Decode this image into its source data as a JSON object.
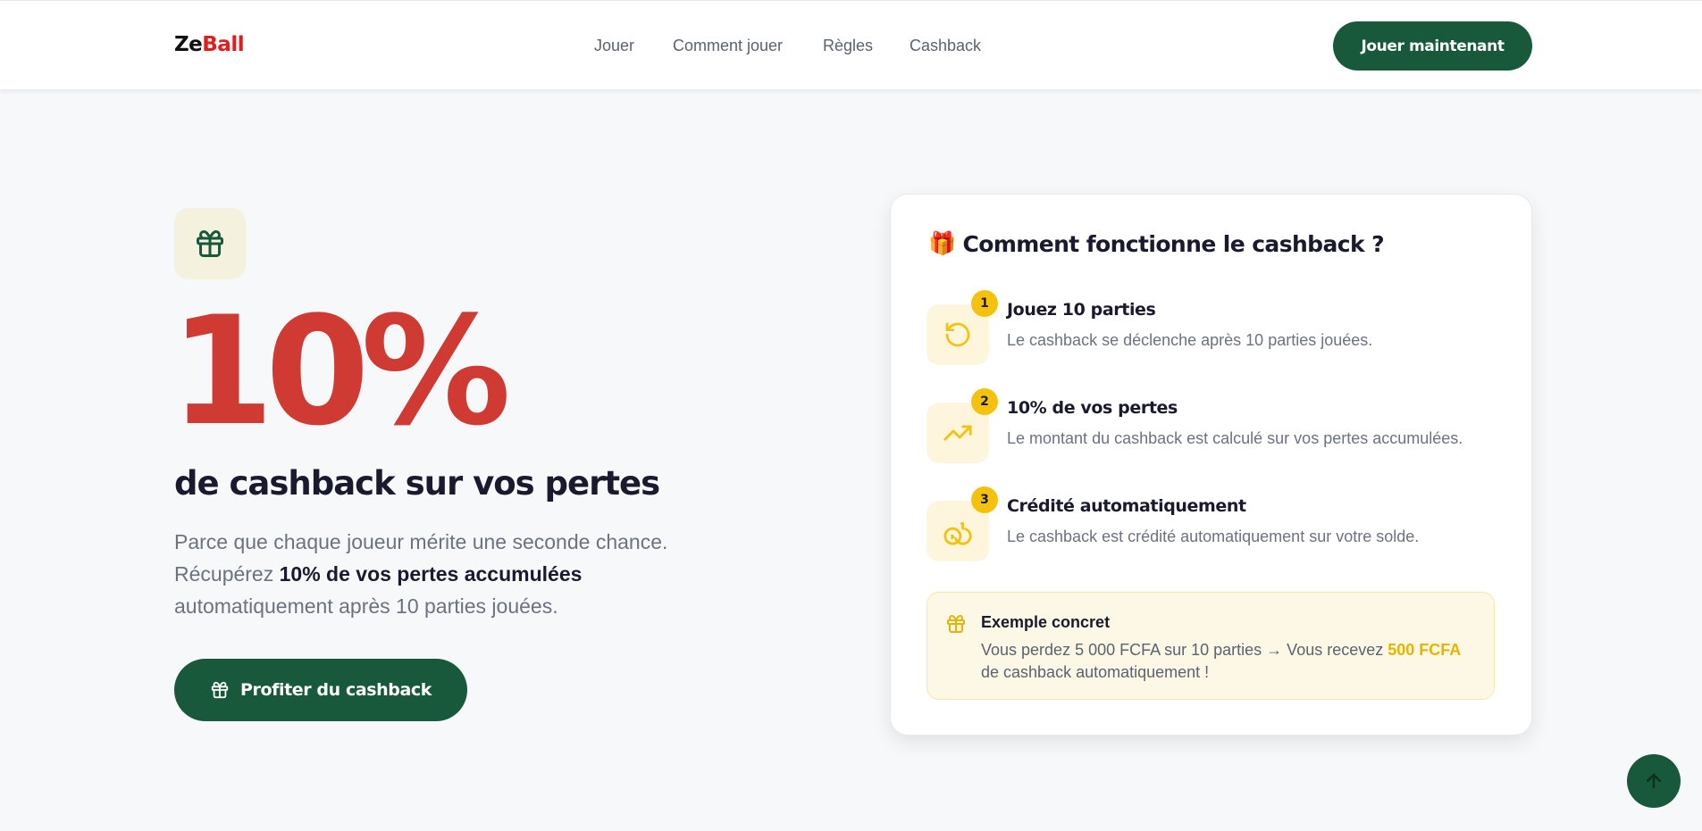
{
  "header": {
    "logo_part1": "Ze",
    "logo_part2": "Ball",
    "nav": [
      "Jouer",
      "Comment jouer",
      "Règles",
      "Cashback"
    ],
    "cta_label": "Jouer maintenant"
  },
  "hero": {
    "big_value": "10%",
    "subtitle": "de cashback sur vos pertes",
    "desc_before": "Parce que chaque joueur mérite une seconde chance. Récupérez ",
    "desc_bold": "10% de vos pertes accumulées",
    "desc_after": " automatiquement après 10 parties jouées.",
    "cta_label": "Profiter du cashback"
  },
  "card": {
    "emoji": "🎁",
    "title": "Comment fonctionne le cashback ?",
    "steps": [
      {
        "num": "1",
        "title": "Jouez 10 parties",
        "text": "Le cashback se déclenche après 10 parties jouées.",
        "icon": "rotate-ccw-icon"
      },
      {
        "num": "2",
        "title": "10% de vos pertes",
        "text": "Le montant du cashback est calculé sur vos pertes accumulées.",
        "icon": "trending-up-icon"
      },
      {
        "num": "3",
        "title": "Crédité automatiquement",
        "text": "Le cashback est crédité automatiquement sur votre solde.",
        "icon": "coins-icon"
      }
    ],
    "example": {
      "title": "Exemple concret",
      "text_before": "Vous perdez 5 000 FCFA sur 10 parties → Vous recevez ",
      "highlight": "500 FCFA",
      "text_after": " de cashback automatiquement !"
    }
  },
  "colors": {
    "primary_green": "#17593a",
    "accent_red": "#cf3a32",
    "accent_yellow": "#f4c20d",
    "logo_red": "#e01e1e"
  }
}
